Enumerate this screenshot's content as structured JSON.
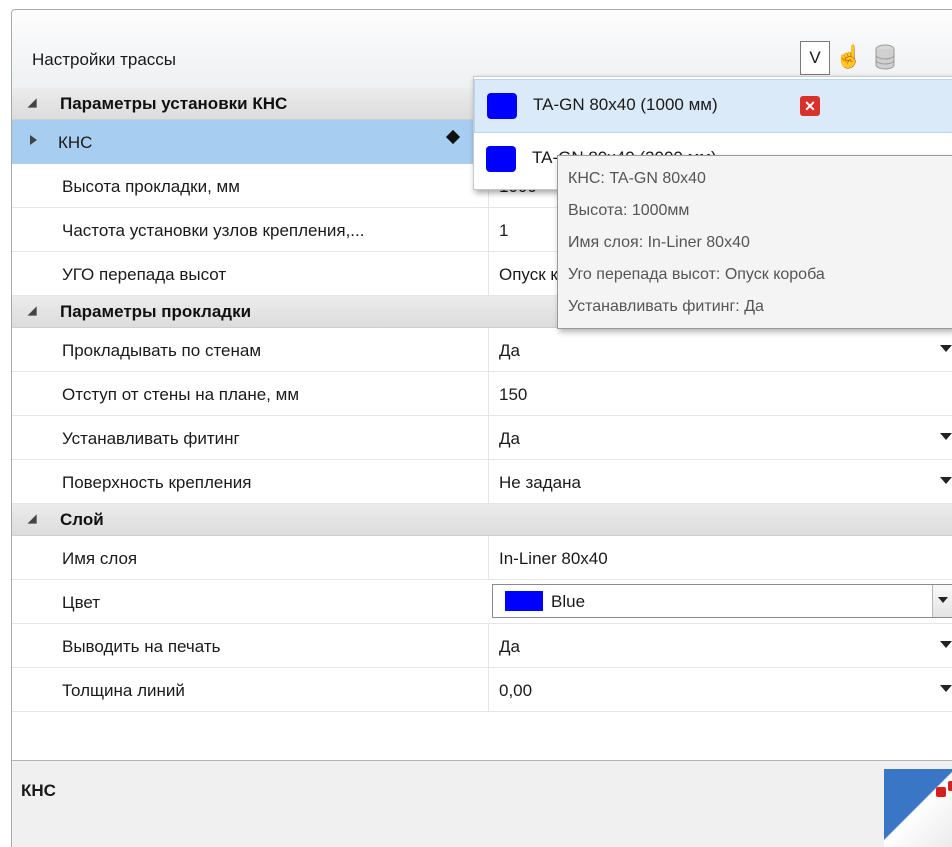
{
  "panel": {
    "title": "Настройки трассы",
    "v_button": "V"
  },
  "categories": {
    "install": "Параметры установки КНС",
    "routing": "Параметры прокладки",
    "layer": "Слой"
  },
  "rows": {
    "kns": {
      "name": "КНС"
    },
    "height": {
      "name": "Высота прокладки, мм",
      "value": "1000"
    },
    "frequency": {
      "name": "Частота установки узлов крепления,...",
      "value": "1"
    },
    "ugo": {
      "name": "УГО перепада высот",
      "value": "Опуск короба"
    },
    "along_walls": {
      "name": "Прокладывать по стенам",
      "value": "Да"
    },
    "offset": {
      "name": "Отступ от стены на плане, мм",
      "value": "150"
    },
    "fitting": {
      "name": "Устанавливать фитинг",
      "value": "Да"
    },
    "surface": {
      "name": "Поверхность крепления",
      "value": "Не задана"
    },
    "layer_name": {
      "name": "Имя слоя",
      "value": "In-Liner 80x40"
    },
    "color": {
      "name": "Цвет",
      "value": "Blue",
      "swatch": "#0000ff"
    },
    "print": {
      "name": "Выводить на печать",
      "value": "Да"
    },
    "line_weight": {
      "name": "Толщина линий",
      "value": "0,00"
    }
  },
  "description": {
    "title": "КНС"
  },
  "popup": {
    "items": [
      {
        "label": "TA-GN 80x40 (1000 мм)",
        "swatch": "#0000ff"
      },
      {
        "label": "TA-GN 80x40 (2000 мм)",
        "swatch": "#0000ff"
      }
    ]
  },
  "tooltip": {
    "lines": [
      "КНС: TA-GN 80x40",
      "Высота: 1000мм",
      "Имя слоя: In-Liner 80x40",
      "Уго перепада высот: Опуск короба",
      "Устанавливать фитинг: Да"
    ]
  },
  "icons": {
    "v": "v-toggle-icon",
    "hand": "hand-pointer-icon",
    "database": "database-icon",
    "delete": "delete-icon"
  }
}
